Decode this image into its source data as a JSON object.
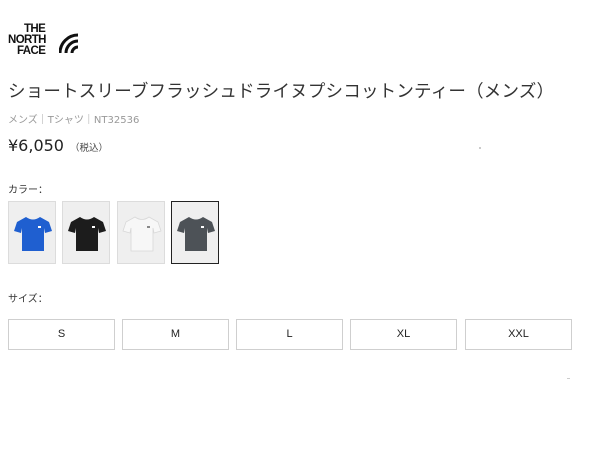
{
  "brand": {
    "logo_lines": [
      "THE",
      "NORTH",
      "FACE"
    ]
  },
  "product": {
    "title": "ショートスリーブフラッシュドライヌプシコットンティー（メンズ）",
    "category_line": "メンズ｜Tシャツ｜NT32536",
    "price": "¥6,050",
    "tax_note": "（税込）"
  },
  "color": {
    "label": "カラー：",
    "options": [
      {
        "name": "blue",
        "hex": "#1f5fd0",
        "selected": false
      },
      {
        "name": "black",
        "hex": "#1c1c1c",
        "selected": false
      },
      {
        "name": "white",
        "hex": "#f7f7f7",
        "selected": false
      },
      {
        "name": "gray",
        "hex": "#4d5257",
        "selected": true
      }
    ]
  },
  "size": {
    "label": "サイズ：",
    "options": [
      "S",
      "M",
      "L",
      "XL",
      "XXL"
    ]
  }
}
